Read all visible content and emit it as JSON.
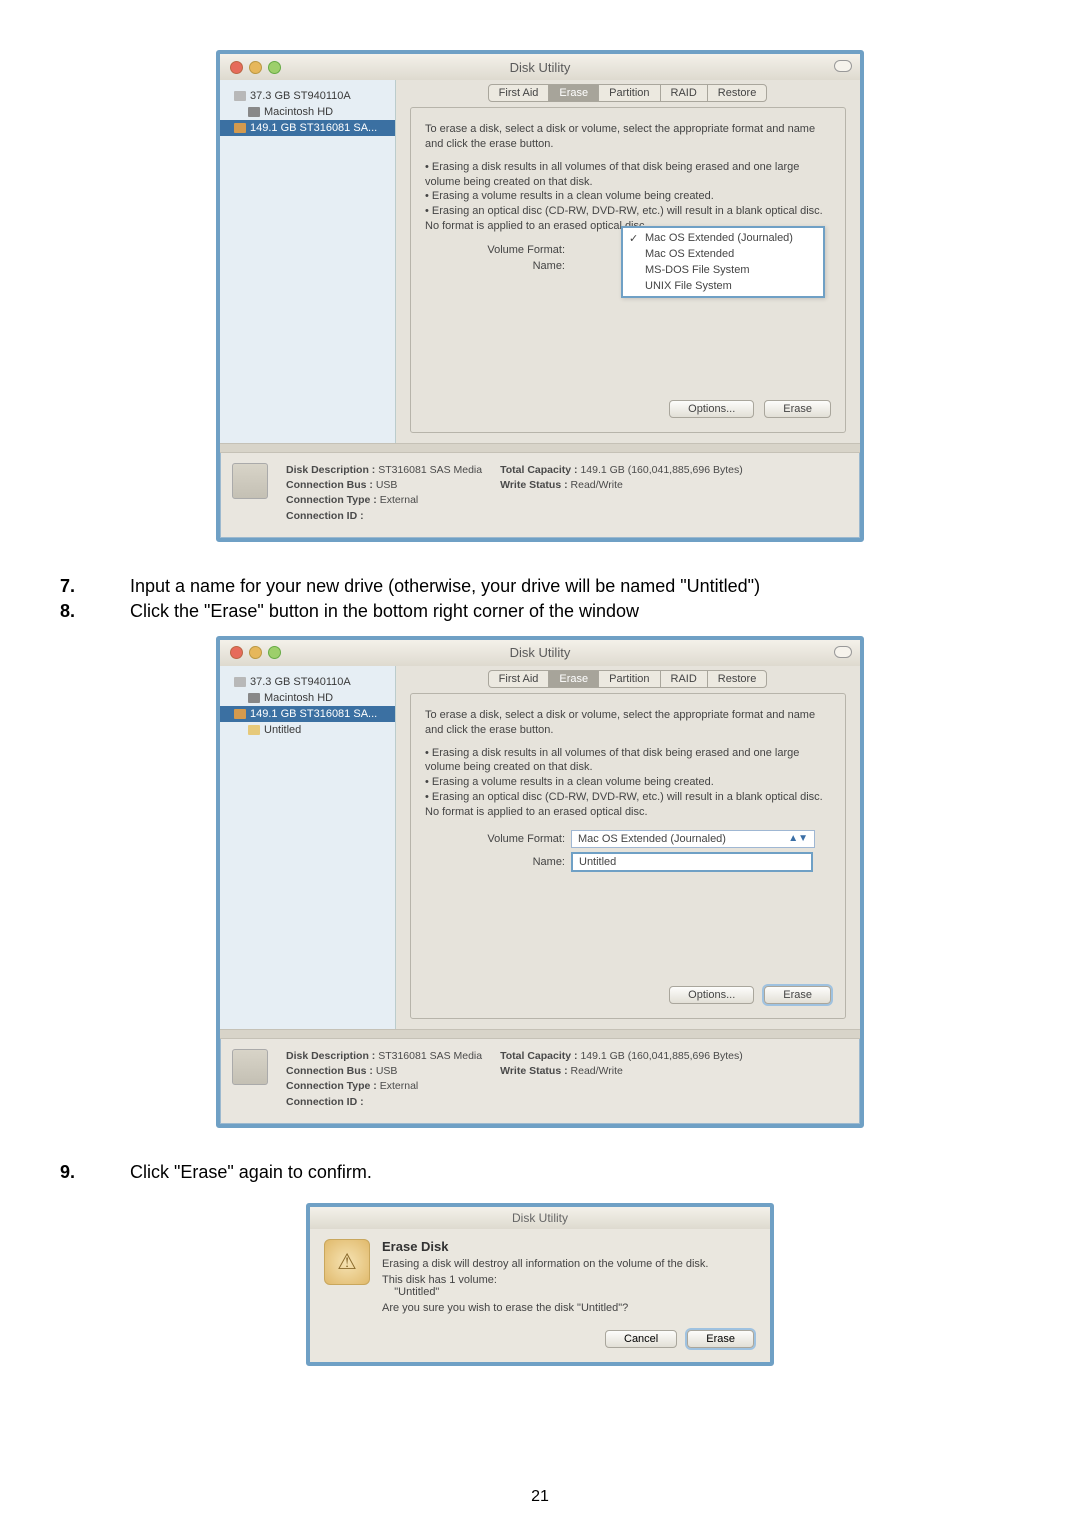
{
  "steps": {
    "s7_num": "7.",
    "s7": "Input a name for your new drive (otherwise, your drive will be named \"Untitled\")",
    "s8_num": "8.",
    "s8": "Click the \"Erase\" button in the bottom right corner of the window",
    "s9_num": "9.",
    "s9": "Click \"Erase\" again to confirm."
  },
  "page_number": "21",
  "win1": {
    "title": "Disk Utility",
    "sidebar": {
      "d0": "37.3 GB ST940110A",
      "d0a": "Macintosh HD",
      "d1": "149.1 GB ST316081 SA..."
    },
    "tabs": {
      "t0": "First Aid",
      "t1": "Erase",
      "t2": "Partition",
      "t3": "RAID",
      "t4": "Restore"
    },
    "desc": "To erase a disk, select a disk or volume, select the appropriate format and name and click the erase button.",
    "b1": "• Erasing a disk results in all volumes of that disk being erased and one large volume being created on that disk.",
    "b2": "• Erasing a volume results in a clean volume being created.",
    "b3": "• Erasing an optical disc (CD-RW, DVD-RW, etc.) will result in a blank optical disc.  No format is applied to an erased optical disc.",
    "label_format": "Volume Format:",
    "label_name": "Name:",
    "dropdown": {
      "o0": "Mac OS Extended (Journaled)",
      "o1": "Mac OS Extended",
      "o2": "MS-DOS File System",
      "o3": "UNIX File System"
    },
    "btn_options": "Options...",
    "btn_erase": "Erase",
    "info": {
      "l1a": "Disk Description :",
      "l1b": "ST316081 SAS Media",
      "l2a": "Connection Bus :",
      "l2b": "USB",
      "l3a": "Connection Type :",
      "l3b": "External",
      "l4a": "Connection ID :",
      "l4b": "",
      "r1a": "Total Capacity :",
      "r1b": "149.1 GB (160,041,885,696 Bytes)",
      "r2a": "Write Status :",
      "r2b": "Read/Write"
    }
  },
  "win2": {
    "title": "Disk Utility",
    "sidebar": {
      "d0": "37.3 GB ST940110A",
      "d0a": "Macintosh HD",
      "d1": "149.1 GB ST316081 SA...",
      "d1a": "Untitled"
    },
    "format_value": "Mac OS Extended (Journaled)",
    "name_value": "Untitled"
  },
  "dialog": {
    "title": "Disk Utility",
    "heading": "Erase Disk",
    "line1": "Erasing a disk will destroy all information on the volume of the disk.",
    "line2a": "This disk has 1 volume:",
    "line2b": "\"Untitled\"",
    "line3": "Are you sure you wish to erase the disk \"Untitled\"?",
    "btn_cancel": "Cancel",
    "btn_erase": "Erase"
  }
}
